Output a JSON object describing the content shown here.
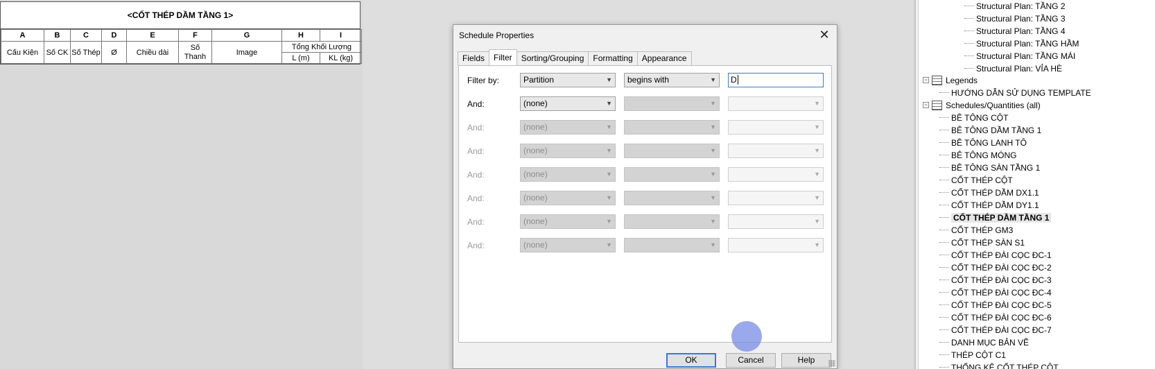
{
  "schedule": {
    "title": "<CỐT THÉP DẦM TẦNG 1>",
    "column_letters": [
      "A",
      "B",
      "C",
      "D",
      "E",
      "F",
      "G",
      "H",
      "I"
    ],
    "headers": [
      "Cấu Kiện",
      "Số CK",
      "Số Thép",
      "Ø",
      "Chiều dài",
      "Số Thanh",
      "Image"
    ],
    "group_header": "Tổng Khối Lượng",
    "sub_headers": [
      "L (m)",
      "KL (kg)"
    ]
  },
  "dialog": {
    "title": "Schedule Properties",
    "close_glyph": "✕",
    "tabs": [
      "Fields",
      "Filter",
      "Sorting/Grouping",
      "Formatting",
      "Appearance"
    ],
    "active_tab": "Filter",
    "filter_by_label": "Filter by:",
    "and_label": "And:",
    "rows": [
      {
        "field": "Partition",
        "condition": "begins with",
        "value": "D"
      },
      {
        "field": "(none)",
        "condition": "",
        "value": ""
      },
      {
        "field": "(none)",
        "condition": "",
        "value": ""
      },
      {
        "field": "(none)",
        "condition": "",
        "value": ""
      },
      {
        "field": "(none)",
        "condition": "",
        "value": ""
      },
      {
        "field": "(none)",
        "condition": "",
        "value": ""
      },
      {
        "field": "(none)",
        "condition": "",
        "value": ""
      },
      {
        "field": "(none)",
        "condition": "",
        "value": ""
      }
    ],
    "buttons": {
      "ok": "OK",
      "cancel": "Cancel",
      "help": "Help"
    }
  },
  "browser": {
    "plans": [
      "Structural Plan: TẦNG 2",
      "Structural Plan: TẦNG 3",
      "Structural Plan: TẦNG 4",
      "Structural Plan: TẦNG HẦM",
      "Structural Plan: TẦNG MÁI",
      "Structural Plan: VỈA HÈ"
    ],
    "legends_label": "Legends",
    "legends_items": [
      "HƯỚNG DẪN SỬ DỤNG TEMPLATE"
    ],
    "schedules_label": "Schedules/Quantities (all)",
    "schedules_items": [
      "BÊ TÔNG CỘT",
      "BÊ TÔNG DẦM TẦNG 1",
      "BÊ TÔNG LANH TÔ",
      "BÊ TÔNG MÓNG",
      "BÊ TÔNG SÀN TẦNG 1",
      "CỐT THÉP CỘT",
      "CỐT THÉP DẦM DX1.1",
      "CỐT THÉP DẦM DY1.1",
      "CỐT THÉP DẦM TẦNG 1",
      "CỐT THÉP GM3",
      "CỐT THÉP SÀN S1",
      "CỐT THÉP ĐÀI CỌC ĐC-1",
      "CỐT THÉP ĐÀI CỌC ĐC-2",
      "CỐT THÉP ĐÀI CỌC ĐC-3",
      "CỐT THÉP ĐÀI CỌC ĐC-4",
      "CỐT THÉP ĐÀI CỌC ĐC-5",
      "CỐT THÉP ĐÀI CỌC ĐC-6",
      "CỐT THÉP ĐÀI CỌC ĐC-7",
      "DANH MỤC BẢN VẼ",
      "THÉP CỘT C1",
      "THỐNG KÊ CỐT THÉP CỘT"
    ],
    "selected_item": "CỐT THÉP DẦM TẦNG 1"
  }
}
